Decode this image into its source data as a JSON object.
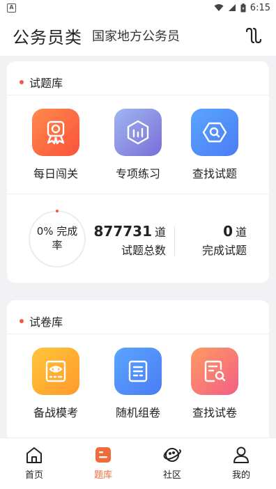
{
  "status_bar": {
    "time": "6:15",
    "icons": [
      "app-notification-icon",
      "wifi-icon",
      "signal-icon",
      "battery-icon"
    ]
  },
  "header": {
    "title": "公务员类",
    "subtitle": "国家地方公务员",
    "switch_icon": "switch-icon"
  },
  "question_bank": {
    "title": "试题库",
    "tiles": [
      {
        "label": "每日闯关",
        "icon": "medal-icon",
        "color": "#f8523b"
      },
      {
        "label": "专项练习",
        "icon": "bar-chart-icon",
        "color": "#7a6ed8"
      },
      {
        "label": "查找试题",
        "icon": "search-icon",
        "color": "#4b7cf3"
      }
    ],
    "progress": {
      "percent": "0%",
      "label_line1": "完成",
      "label_line2": "率",
      "value": 0
    },
    "total": {
      "number": "877731",
      "unit": "道",
      "caption": "试题总数"
    },
    "done": {
      "number": "0",
      "unit": "道",
      "caption": "完成试题"
    }
  },
  "paper_bank": {
    "title": "试卷库",
    "tiles": [
      {
        "label": "备战模考",
        "icon": "exam-eye-icon",
        "color": "#ff9a2b"
      },
      {
        "label": "随机组卷",
        "icon": "random-paper-icon",
        "color": "#4b7cf3"
      },
      {
        "label": "查找试卷",
        "icon": "search-paper-icon",
        "color": "#f25f84"
      }
    ]
  },
  "tabbar": {
    "items": [
      {
        "label": "首页",
        "icon": "home-icon"
      },
      {
        "label": "题库",
        "icon": "question-bank-icon"
      },
      {
        "label": "社区",
        "icon": "planet-icon"
      },
      {
        "label": "我的",
        "icon": "profile-icon"
      }
    ],
    "active_index": 1,
    "active_color": "#f06a3c"
  }
}
